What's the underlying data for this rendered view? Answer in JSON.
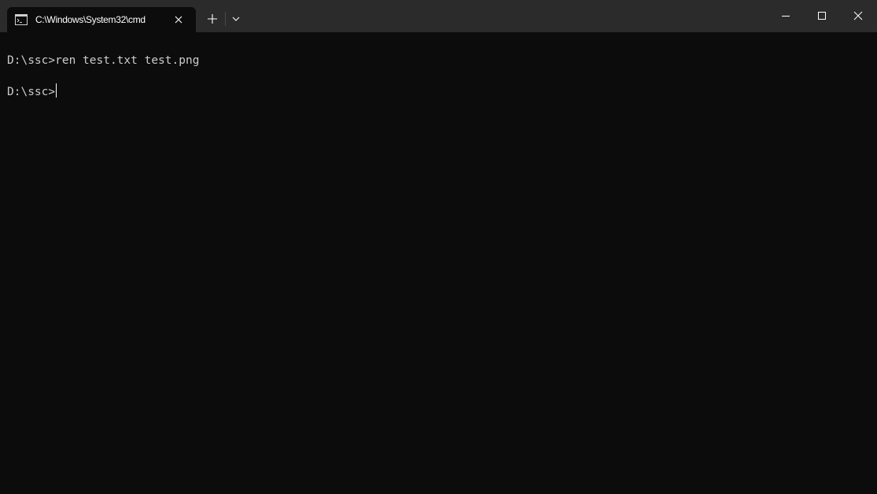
{
  "window": {
    "tab_title": "C:\\Windows\\System32\\cmd",
    "colors": {
      "titlebar": "#2b2b2b",
      "terminal_bg": "#0c0c0c",
      "text": "#cccccc"
    },
    "icons": {
      "tab": "cmd-icon",
      "tab_close": "close-icon",
      "new_tab": "plus-icon",
      "dropdown": "chevron-down-icon",
      "minimize": "minimize-icon",
      "maximize": "maximize-icon",
      "close": "close-icon"
    }
  },
  "terminal": {
    "lines": [
      "D:\\ssc>ren test.txt test.png",
      "D:\\ssc>"
    ]
  }
}
